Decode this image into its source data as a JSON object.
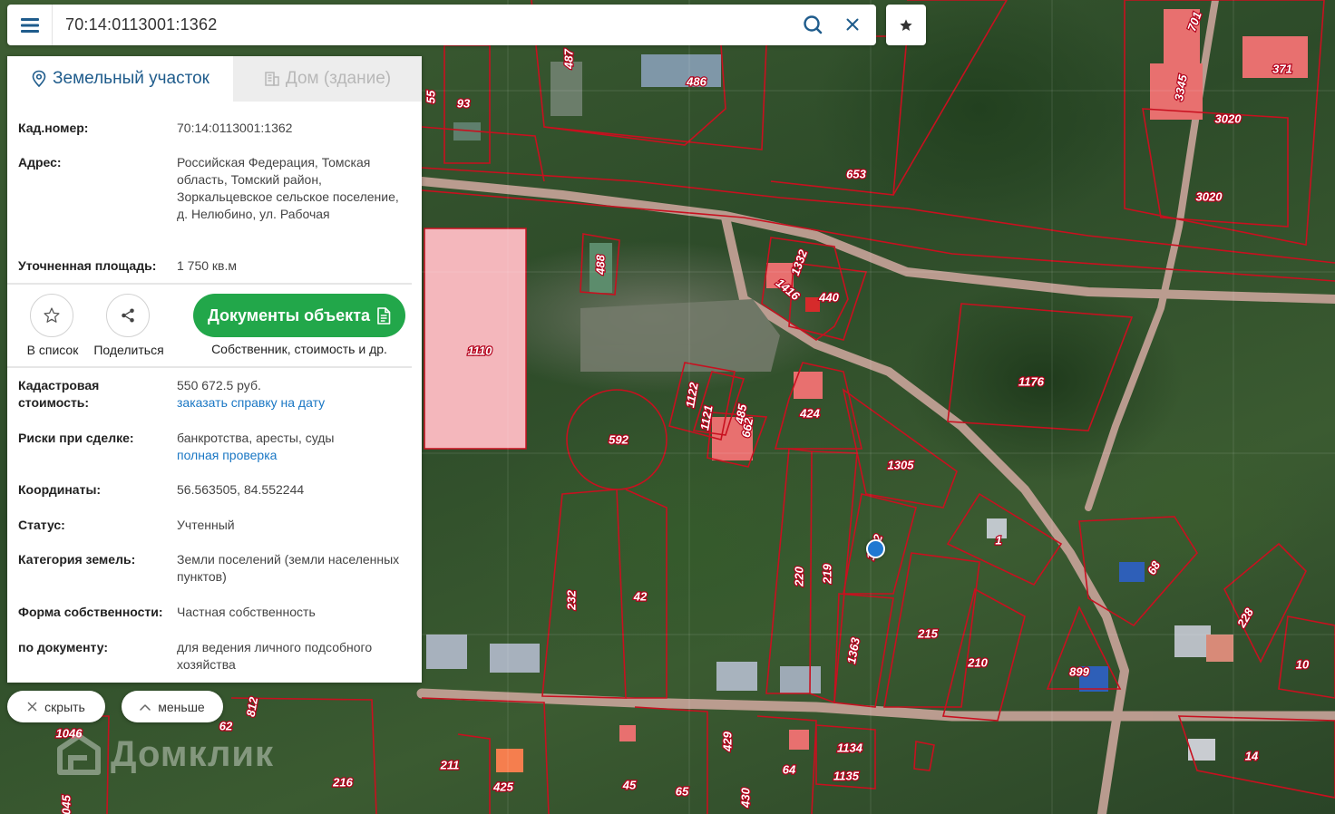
{
  "search": {
    "query": "70:14:0113001:1362"
  },
  "tabs": {
    "land": "Земельный участок",
    "building": "Дом (здание)"
  },
  "info": {
    "cad_label": "Кад.номер:",
    "cad_value": "70:14:0113001:1362",
    "address_label": "Адрес:",
    "address_value": "Российская Федерация, Томская область, Томский район, Зоркальцевское сельское поселение, д. Нелюбино, ул. Рабочая",
    "area_label": "Уточненная площадь:",
    "area_value": "1 750 кв.м"
  },
  "actions": {
    "to_list": "В список",
    "share": "Поделиться",
    "documents": "Документы объекта",
    "documents_sub": "Собственник, стоимость и др."
  },
  "details": {
    "cost_label": "Кадастровая стоимость:",
    "cost_value": "550 672.5 руб.",
    "cost_link": "заказать справку на дату",
    "risk_label": "Риски при сделке:",
    "risk_value": "банкротства, аресты, суды",
    "risk_link": "полная проверка",
    "coords_label": "Координаты:",
    "coords_value": "56.563505, 84.552244",
    "status_label": "Статус:",
    "status_value": "Учтенный",
    "category_label": "Категория земель:",
    "category_value": "Земли поселений (земли населенных пунктов)",
    "ownership_label": "Форма собственности:",
    "ownership_value": "Частная собственность",
    "doc_label": "по документу:",
    "doc_value": "для ведения личного подсобного хозяйства"
  },
  "controls": {
    "hide": "скрыть",
    "less": "меньше"
  },
  "watermark": "Домклик",
  "map_labels": [
    "487",
    "486",
    "55",
    "93",
    "653",
    "701",
    "371",
    "3345",
    "3020",
    "3020",
    "488",
    "1332",
    "1416",
    "440",
    "1110",
    "1176",
    "1122",
    "1121",
    "485",
    "662",
    "424",
    "592",
    "1305",
    "1",
    "68",
    "228",
    "10",
    "42",
    "232",
    "220",
    "219",
    "1363",
    "215",
    "210",
    "899",
    "812",
    "62",
    "1046",
    "211",
    "216",
    "425",
    "45",
    "65",
    "429",
    "430",
    "64",
    "1134",
    "1135",
    "14",
    "045",
    "1362"
  ],
  "colors": {
    "accent": "#1a77c4",
    "button_green": "#22a74a",
    "parcel_border": "#c8101f",
    "highlight_parcel": "#f4b7bc"
  }
}
